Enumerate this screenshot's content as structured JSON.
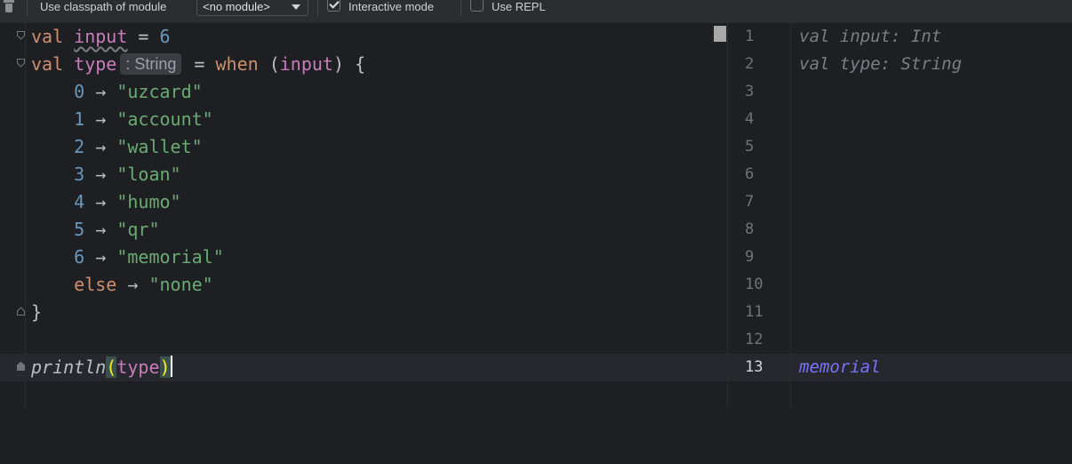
{
  "toolbar": {
    "classpath_label": "Use classpath of module",
    "module_value": "<no module>",
    "interactive_label": "Interactive mode",
    "interactive_checked": true,
    "repl_label": "Use REPL",
    "repl_checked": false
  },
  "code": {
    "l1": {
      "kw": "val",
      "name": "input",
      "rest": " = ",
      "num": "6"
    },
    "l2": {
      "kw": "val",
      "name": "type",
      "hint": ": String",
      "eq": " = ",
      "when": "when",
      "open": " (",
      "arg": "input",
      "close": ") {"
    },
    "cases": [
      {
        "key": "0",
        "arrow": " → ",
        "val": "\"uzcard\""
      },
      {
        "key": "1",
        "arrow": " → ",
        "val": "\"account\""
      },
      {
        "key": "2",
        "arrow": " → ",
        "val": "\"wallet\""
      },
      {
        "key": "3",
        "arrow": " → ",
        "val": "\"loan\""
      },
      {
        "key": "4",
        "arrow": " → ",
        "val": "\"humo\""
      },
      {
        "key": "5",
        "arrow": " → ",
        "val": "\"qr\""
      },
      {
        "key": "6",
        "arrow": " → ",
        "val": "\"memorial\""
      }
    ],
    "else": {
      "kw": "else",
      "arrow": " → ",
      "val": "\"none\""
    },
    "close_brace": "}",
    "println": {
      "fn": "println",
      "lp": "(",
      "arg": "type",
      "rp": ")"
    }
  },
  "line_numbers": [
    "1",
    "2",
    "3",
    "4",
    "5",
    "6",
    "7",
    "8",
    "9",
    "10",
    "11",
    "12",
    "13"
  ],
  "results": {
    "r1": "val input: Int",
    "r2": "val type: String",
    "r13": "memorial"
  },
  "icons": {
    "trash": "trash-icon",
    "fold": "fold-marker-icon",
    "dropdown": "chevron-down-icon"
  },
  "colors": {
    "keyword": "#cf8e6d",
    "number": "#6897bb",
    "string": "#6aab73",
    "identifier": "#c77dbb",
    "result_output": "#7a73ff"
  }
}
